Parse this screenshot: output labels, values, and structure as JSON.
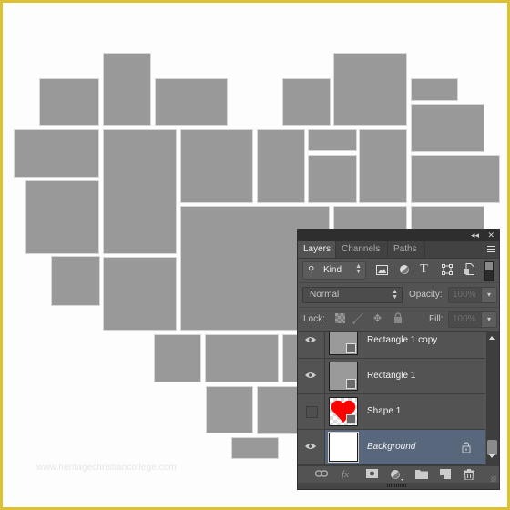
{
  "canvas": {
    "border_color": "#dcc232",
    "tile_color": "#999999",
    "watermark": "www.heritagechristiancollege.com",
    "tile_count": 30
  },
  "layers_panel": {
    "controls": {
      "collapse": "◂◂",
      "close": "✕"
    },
    "tabs": [
      {
        "label": "Layers",
        "active": true
      },
      {
        "label": "Channels",
        "active": false
      },
      {
        "label": "Paths",
        "active": false
      }
    ],
    "filter": {
      "kind_label": "Kind",
      "filter_icons": [
        "image-filter-icon",
        "adjustment-filter-icon",
        "type-filter-icon",
        "shape-filter-icon",
        "smart-object-filter-icon"
      ]
    },
    "blend": {
      "mode": "Normal",
      "opacity_label": "Opacity:",
      "opacity_value": "100%"
    },
    "lock": {
      "label": "Lock:",
      "fill_label": "Fill:",
      "fill_value": "100%"
    },
    "layers": [
      {
        "name": "Rectangle 1 copy",
        "visible": true,
        "type": "shape",
        "selected": false,
        "locked": false
      },
      {
        "name": "Rectangle 1",
        "visible": true,
        "type": "shape",
        "selected": false,
        "locked": false
      },
      {
        "name": "Shape 1",
        "visible": false,
        "type": "shape-heart",
        "selected": false,
        "locked": false
      },
      {
        "name": "Background",
        "visible": true,
        "type": "background",
        "selected": true,
        "locked": true
      }
    ],
    "footer_buttons": [
      "link-layers",
      "add-layer-style",
      "add-layer-mask",
      "new-adjustment-layer",
      "new-group",
      "new-layer",
      "delete-layer"
    ],
    "accent_selected": "#59677c"
  }
}
